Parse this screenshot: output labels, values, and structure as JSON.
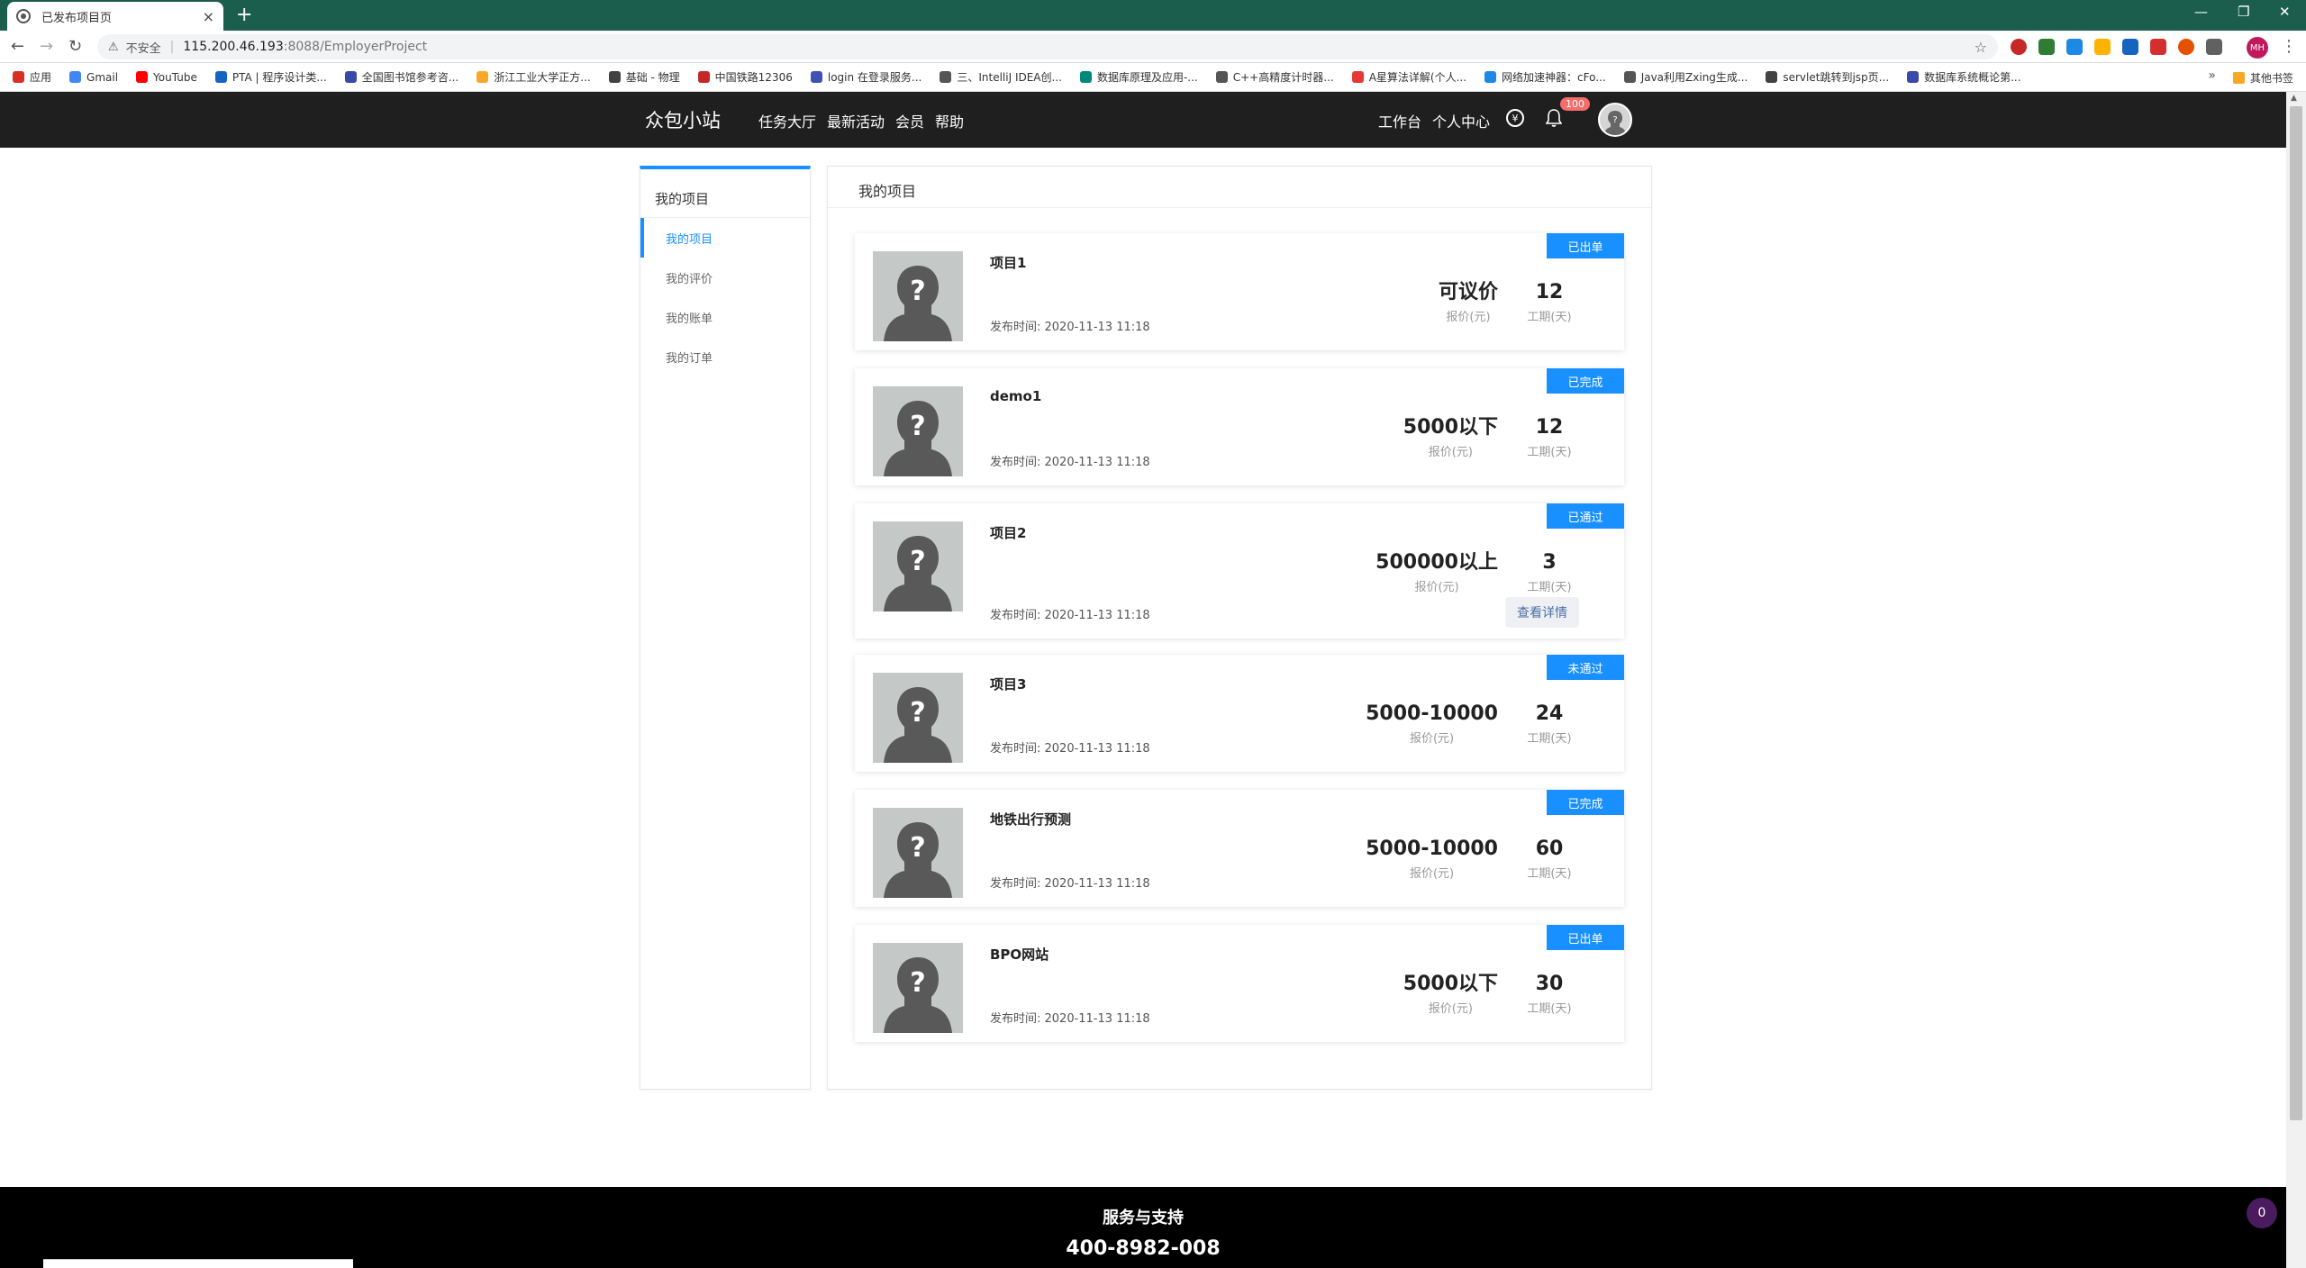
{
  "browser": {
    "tab_title": "已发布项目页",
    "tab_close": "×",
    "new_tab": "+",
    "window_controls": [
      "—",
      "❐",
      "✕"
    ],
    "nav_back": "←",
    "nav_forward": "→",
    "nav_reload": "↻",
    "security_warning": "⚠",
    "security_text": "不安全",
    "url_separator": "|",
    "url_host": "115.200.46.193",
    "url_path": ":8088/EmployerProject",
    "bookmark_star": "☆",
    "profile_initials": "MH",
    "menu_dots": "⋮",
    "bookmarks": [
      {
        "label": "应用",
        "color": "#d93025"
      },
      {
        "label": "Gmail",
        "color": "#4285f4"
      },
      {
        "label": "YouTube",
        "color": "#ff0000"
      },
      {
        "label": "PTA | 程序设计类...",
        "color": "#1565c0"
      },
      {
        "label": "全国图书馆参考咨...",
        "color": "#3949ab"
      },
      {
        "label": "浙江工业大学正方...",
        "color": "#f9a825"
      },
      {
        "label": "基础 - 物理",
        "color": "#424242"
      },
      {
        "label": "中国铁路12306",
        "color": "#c62828"
      },
      {
        "label": "login 在登录服务...",
        "color": "#3f51b5"
      },
      {
        "label": "三、IntelliJ IDEA创...",
        "color": "#555555"
      },
      {
        "label": "数据库原理及应用-...",
        "color": "#00897b"
      },
      {
        "label": "C++高精度计时器...",
        "color": "#555555"
      },
      {
        "label": "A星算法详解(个人...",
        "color": "#e53935"
      },
      {
        "label": "网络加速神器：cFo...",
        "color": "#1e88e5"
      },
      {
        "label": "Java利用Zxing生成...",
        "color": "#555555"
      },
      {
        "label": "servlet跳转到jsp页...",
        "color": "#424242"
      },
      {
        "label": "数据库系统概论第...",
        "color": "#3949ab"
      }
    ],
    "bookmarks_more": "»",
    "other_bookmarks": "其他书签"
  },
  "site": {
    "brand": "众包小站",
    "main_nav": [
      "任务大厅",
      "最新活动",
      "会员",
      "帮助"
    ],
    "right_nav": [
      "工作台",
      "个人中心"
    ],
    "coin_symbol": "¥",
    "notification_count": "100"
  },
  "sidebar": {
    "title": "我的项目",
    "items": [
      {
        "label": "我的项目",
        "active": true
      },
      {
        "label": "我的评价",
        "active": false
      },
      {
        "label": "我的账单",
        "active": false
      },
      {
        "label": "我的订单",
        "active": false
      }
    ]
  },
  "main": {
    "title": "我的项目",
    "price_label": "报价(元)",
    "period_label": "工期(天)",
    "time_prefix": "发布时间: ",
    "detail_button": "查看详情",
    "projects": [
      {
        "name": "项目1",
        "status": "已出单",
        "price": "可议价",
        "period": "12",
        "time": "2020-11-13 11:18"
      },
      {
        "name": "demo1",
        "status": "已完成",
        "price": "5000以下",
        "period": "12",
        "time": "2020-11-13 11:18"
      },
      {
        "name": "项目2",
        "status": "已通过",
        "price": "500000以上",
        "period": "3",
        "time": "2020-11-13 11:18"
      },
      {
        "name": "项目3",
        "status": "未通过",
        "price": "5000-10000",
        "period": "24",
        "time": "2020-11-13 11:18"
      },
      {
        "name": "地铁出行预测",
        "status": "已完成",
        "price": "5000-10000",
        "period": "60",
        "time": "2020-11-13 11:18"
      },
      {
        "name": "BPO网站",
        "status": "已出单",
        "price": "5000以下",
        "period": "30",
        "time": "2020-11-13 11:18"
      }
    ]
  },
  "footer": {
    "title": "服务与支持",
    "phone": "400-8982-008",
    "chat_count": "0"
  }
}
